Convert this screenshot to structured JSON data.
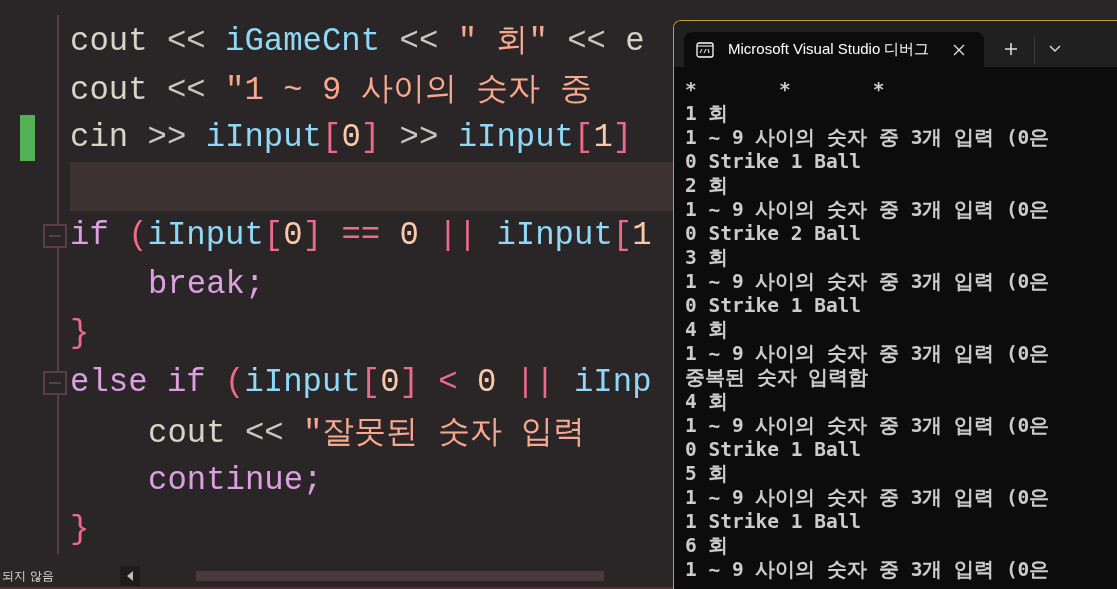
{
  "editor": {
    "lines": [
      {
        "changed": false,
        "highlighted": false,
        "fold": false,
        "indented": false,
        "tokens": [
          {
            "text": "cout ",
            "kind": "plain"
          },
          {
            "text": "<< ",
            "kind": "op"
          },
          {
            "text": "iGameCnt ",
            "kind": "var"
          },
          {
            "text": "<< ",
            "kind": "op"
          },
          {
            "text": "\" 회\" ",
            "kind": "string"
          },
          {
            "text": "<< ",
            "kind": "op"
          },
          {
            "text": "e",
            "kind": "plain"
          }
        ]
      },
      {
        "changed": false,
        "highlighted": false,
        "fold": false,
        "indented": false,
        "tokens": [
          {
            "text": "cout ",
            "kind": "plain"
          },
          {
            "text": "<< ",
            "kind": "op"
          },
          {
            "text": "\"1 ~ 9 사이의 숫자 중",
            "kind": "string"
          }
        ]
      },
      {
        "changed": true,
        "highlighted": false,
        "fold": false,
        "indented": false,
        "tokens": [
          {
            "text": "cin ",
            "kind": "plain"
          },
          {
            "text": ">> ",
            "kind": "op"
          },
          {
            "text": "iInput",
            "kind": "var"
          },
          {
            "text": "[",
            "kind": "punct"
          },
          {
            "text": "0",
            "kind": "number"
          },
          {
            "text": "] ",
            "kind": "punct"
          },
          {
            "text": ">> ",
            "kind": "op"
          },
          {
            "text": "iInput",
            "kind": "var"
          },
          {
            "text": "[",
            "kind": "punct"
          },
          {
            "text": "1",
            "kind": "number"
          },
          {
            "text": "]",
            "kind": "punct"
          }
        ]
      },
      {
        "changed": false,
        "highlighted": true,
        "fold": false,
        "indented": false
      },
      {
        "changed": false,
        "highlighted": false,
        "fold": true,
        "indented": false,
        "tokens": [
          {
            "text": "if ",
            "kind": "keyword"
          },
          {
            "text": "(",
            "kind": "punct"
          },
          {
            "text": "iInput",
            "kind": "var"
          },
          {
            "text": "[",
            "kind": "punct"
          },
          {
            "text": "0",
            "kind": "number"
          },
          {
            "text": "] ",
            "kind": "punct"
          },
          {
            "text": "== ",
            "kind": "punct"
          },
          {
            "text": "0 ",
            "kind": "number"
          },
          {
            "text": "|| ",
            "kind": "punct"
          },
          {
            "text": "iInput",
            "kind": "var"
          },
          {
            "text": "[",
            "kind": "punct"
          },
          {
            "text": "1",
            "kind": "number"
          }
        ]
      },
      {
        "changed": false,
        "highlighted": false,
        "fold": false,
        "indented": true,
        "tokens": [
          {
            "text": "break;",
            "kind": "keyword"
          }
        ]
      },
      {
        "changed": false,
        "highlighted": false,
        "fold": false,
        "indented": false,
        "tokens": [
          {
            "text": "}",
            "kind": "punct"
          }
        ]
      },
      {
        "changed": false,
        "highlighted": false,
        "fold": true,
        "indented": false,
        "tokens": [
          {
            "text": "else if ",
            "kind": "keyword"
          },
          {
            "text": "(",
            "kind": "punct"
          },
          {
            "text": "iInput",
            "kind": "var"
          },
          {
            "text": "[",
            "kind": "punct"
          },
          {
            "text": "0",
            "kind": "number"
          },
          {
            "text": "] ",
            "kind": "punct"
          },
          {
            "text": "< ",
            "kind": "punct"
          },
          {
            "text": "0 ",
            "kind": "number"
          },
          {
            "text": "|| ",
            "kind": "punct"
          },
          {
            "text": "iInp",
            "kind": "var"
          }
        ]
      },
      {
        "changed": false,
        "highlighted": false,
        "fold": false,
        "indented": true,
        "tokens": [
          {
            "text": "cout ",
            "kind": "plain"
          },
          {
            "text": "<< ",
            "kind": "op"
          },
          {
            "text": "\"잘못된 숫자 입력",
            "kind": "string"
          }
        ]
      },
      {
        "changed": false,
        "highlighted": false,
        "fold": false,
        "indented": true,
        "tokens": [
          {
            "text": "continue;",
            "kind": "keyword"
          }
        ]
      },
      {
        "changed": false,
        "highlighted": false,
        "fold": false,
        "indented": false,
        "tokens": [
          {
            "text": "}",
            "kind": "punct"
          }
        ]
      }
    ],
    "status": "되지 않음"
  },
  "console": {
    "tab_title": "Microsoft Visual Studio 디버그",
    "lines": [
      "*       *       *",
      "1 회",
      "1 ~ 9 사이의 숫자 중 3개 입력 (0은",
      "0 Strike 1 Ball",
      "2 회",
      "1 ~ 9 사이의 숫자 중 3개 입력 (0은",
      "0 Strike 2 Ball",
      "3 회",
      "1 ~ 9 사이의 숫자 중 3개 입력 (0은",
      "0 Strike 1 Ball",
      "4 회",
      "1 ~ 9 사이의 숫자 중 3개 입력 (0은",
      "중복된 숫자 입력함",
      "4 회",
      "1 ~ 9 사이의 숫자 중 3개 입력 (0은",
      "0 Strike 1 Ball",
      "5 회",
      "1 ~ 9 사이의 숫자 중 3개 입력 (0은",
      "1 Strike 1 Ball",
      "6 회",
      "1 ~ 9 사이의 숫자 중 3개 입력 (0은"
    ]
  }
}
